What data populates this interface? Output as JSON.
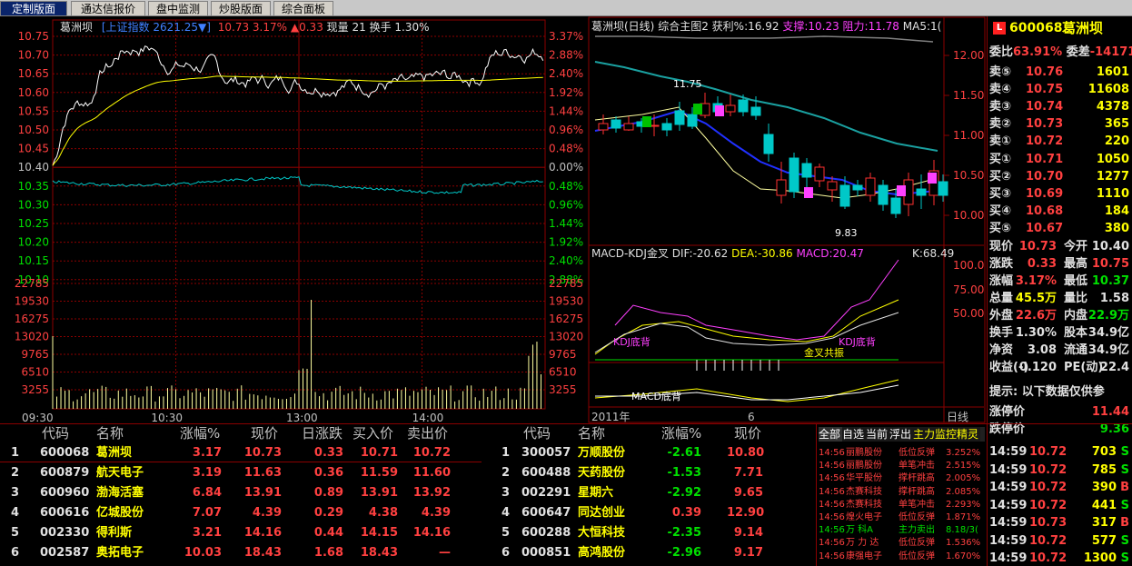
{
  "tabs": [
    "定制版面",
    "通达信报价",
    "盘中监测",
    "炒股版面",
    "综合面板"
  ],
  "intraday": {
    "stock_name": "葛洲坝",
    "index_label": "[上证指数",
    "index_value": "2621.25▼]",
    "price": "10.73",
    "pct": "3.17%",
    "change": "▲0.33",
    "current_vol": "现量 21",
    "turnover": "换手 1.30%",
    "price_ticks": [
      "10.75",
      "10.70",
      "10.65",
      "10.60",
      "10.55",
      "10.50",
      "10.45",
      "10.40",
      "10.35",
      "10.30",
      "10.25",
      "10.20",
      "10.15",
      "10.10"
    ],
    "pct_ticks": [
      "3.37%",
      "2.88%",
      "2.40%",
      "1.92%",
      "1.44%",
      "0.96%",
      "0.48%",
      "0.00%",
      "0.48%",
      "0.96%",
      "1.44%",
      "1.92%",
      "2.40%",
      "2.88%"
    ],
    "vol_ticks": [
      "22785",
      "19530",
      "16275",
      "13020",
      "9765",
      "6510",
      "3255"
    ],
    "time_ticks": [
      "09:30",
      "10:30",
      "13:00",
      "14:00"
    ]
  },
  "daily": {
    "title": "葛洲坝(日线)",
    "subtitle": "综合主图2",
    "profit": "获利%:16.92",
    "support": "支撑:10.23",
    "resist": "阻力:11.78",
    "ma": "MA5:1(",
    "price_ticks": [
      "12.00",
      "11.50",
      "11.00",
      "10.50",
      "10.00"
    ],
    "high_label": "11.75",
    "low_label": "9.83",
    "sub_title": "MACD-KDJ金叉",
    "dif": "DIF:-20.62",
    "dea": "DEA:-30.86",
    "macd": "MACD:20.47",
    "k": "K:68.49",
    "ind_ticks": [
      "100.0",
      "75.00",
      "50.00"
    ],
    "ann_kdj1": "KDJ底背",
    "ann_kdj2": "KDJ底背",
    "ann_cross": "金叉共振",
    "ann_macd": "MACD底背",
    "year": "2011年",
    "month": "6",
    "period": "日线"
  },
  "quote": {
    "code": "600068",
    "name": "葛洲坝",
    "weibi_label": "委比",
    "weibi": "63.91%",
    "weicha_label": "委差",
    "weicha": "-14171",
    "asks": [
      [
        "卖⑤",
        "10.76",
        "1601"
      ],
      [
        "卖④",
        "10.75",
        "11608"
      ],
      [
        "卖③",
        "10.74",
        "4378"
      ],
      [
        "卖②",
        "10.73",
        "365"
      ],
      [
        "卖①",
        "10.72",
        "220"
      ]
    ],
    "bids": [
      [
        "买①",
        "10.71",
        "1050"
      ],
      [
        "买②",
        "10.70",
        "1277"
      ],
      [
        "买③",
        "10.69",
        "1110"
      ],
      [
        "买④",
        "10.68",
        "184"
      ],
      [
        "买⑤",
        "10.67",
        "380"
      ]
    ],
    "stats": [
      [
        "现价",
        "10.73",
        "今开",
        "10.40"
      ],
      [
        "涨跌",
        "0.33",
        "最高",
        "10.75"
      ],
      [
        "涨幅",
        "3.17%",
        "最低",
        "10.37"
      ],
      [
        "总量",
        "45.5万",
        "量比",
        "1.58"
      ],
      [
        "外盘",
        "22.6万",
        "内盘",
        "22.9万"
      ],
      [
        "换手",
        "1.30%",
        "股本",
        "34.9亿"
      ],
      [
        "净资",
        "3.08",
        "流通",
        "34.9亿"
      ],
      [
        "收益(-)",
        "0.120",
        "PE(动)",
        "22.4"
      ]
    ],
    "tip": "提示:  以下数据仅供参",
    "limit_up_label": "涨停价",
    "limit_up": "11.44",
    "limit_down_label": "跌停价",
    "limit_down": "9.36"
  },
  "table1": {
    "headers": [
      "代码",
      "名称",
      "涨幅%",
      "现价",
      "日涨跌",
      "买入价",
      "卖出价"
    ],
    "rows": [
      [
        "1",
        "600068",
        "葛洲坝",
        "3.17",
        "10.73",
        "0.33",
        "10.71",
        "10.72"
      ],
      [
        "2",
        "600879",
        "航天电子",
        "3.19",
        "11.63",
        "0.36",
        "11.59",
        "11.60"
      ],
      [
        "3",
        "600960",
        "渤海活塞",
        "6.84",
        "13.91",
        "0.89",
        "13.91",
        "13.92"
      ],
      [
        "4",
        "600616",
        "亿城股份",
        "7.07",
        "4.39",
        "0.29",
        "4.38",
        "4.39"
      ],
      [
        "5",
        "002330",
        "得利斯",
        "3.21",
        "14.16",
        "0.44",
        "14.15",
        "14.16"
      ],
      [
        "6",
        "002587",
        "奥拓电子",
        "10.03",
        "18.43",
        "1.68",
        "18.43",
        "—"
      ]
    ]
  },
  "table2": {
    "headers": [
      "代码",
      "名称",
      "涨幅%",
      "现价"
    ],
    "rows": [
      [
        "1",
        "300057",
        "万顺股份",
        "-2.61",
        "10.80"
      ],
      [
        "2",
        "600488",
        "天药股份",
        "-1.53",
        "7.71"
      ],
      [
        "3",
        "002291",
        "星期六",
        "-2.92",
        "9.65"
      ],
      [
        "4",
        "600647",
        "同达创业",
        "0.39",
        "12.90"
      ],
      [
        "5",
        "600288",
        "大恒科技",
        "-2.35",
        "9.14"
      ],
      [
        "6",
        "000851",
        "高鸿股份",
        "-2.96",
        "9.17"
      ]
    ]
  },
  "monitor": {
    "tabs": [
      "全部",
      "自选",
      "当前",
      "浮出",
      "主力监控精灵"
    ],
    "rows": [
      [
        "14:56",
        "丽鹏股份",
        "低位反弹",
        "3.252%"
      ],
      [
        "14:56",
        "丽鹏股份",
        "单笔冲击",
        "2.515%"
      ],
      [
        "14:56",
        "华平股份",
        "撑杆跳高",
        "2.005%"
      ],
      [
        "14:56",
        "杰赛科技",
        "撑杆跳高",
        "2.085%"
      ],
      [
        "14:56",
        "杰赛科技",
        "单笔冲击",
        "2.293%"
      ],
      [
        "14:56",
        "煌火电子",
        "低位反弹",
        "1.871%"
      ],
      [
        "14:56",
        "万  科A",
        "主力卖出",
        "8.18/3("
      ],
      [
        "14:56",
        "万 力 达",
        "低位反弹",
        "1.536%"
      ],
      [
        "14:56",
        "康强电子",
        "低位反弹",
        "1.670%"
      ]
    ]
  },
  "trades": {
    "rows": [
      [
        "14:59",
        "10.72",
        "703",
        "S"
      ],
      [
        "14:59",
        "10.72",
        "785",
        "S"
      ],
      [
        "14:59",
        "10.72",
        "390",
        "B"
      ],
      [
        "14:59",
        "10.72",
        "441",
        "S"
      ],
      [
        "14:59",
        "10.73",
        "317",
        "B"
      ],
      [
        "14:59",
        "10.72",
        "577",
        "S"
      ],
      [
        "14:59",
        "10.72",
        "1300",
        "S"
      ]
    ]
  },
  "colors": {
    "up": "#ff4040",
    "down": "#00e000",
    "grid": "#8b0000",
    "yellow": "#ffff00",
    "cyan": "#00c8c8"
  }
}
